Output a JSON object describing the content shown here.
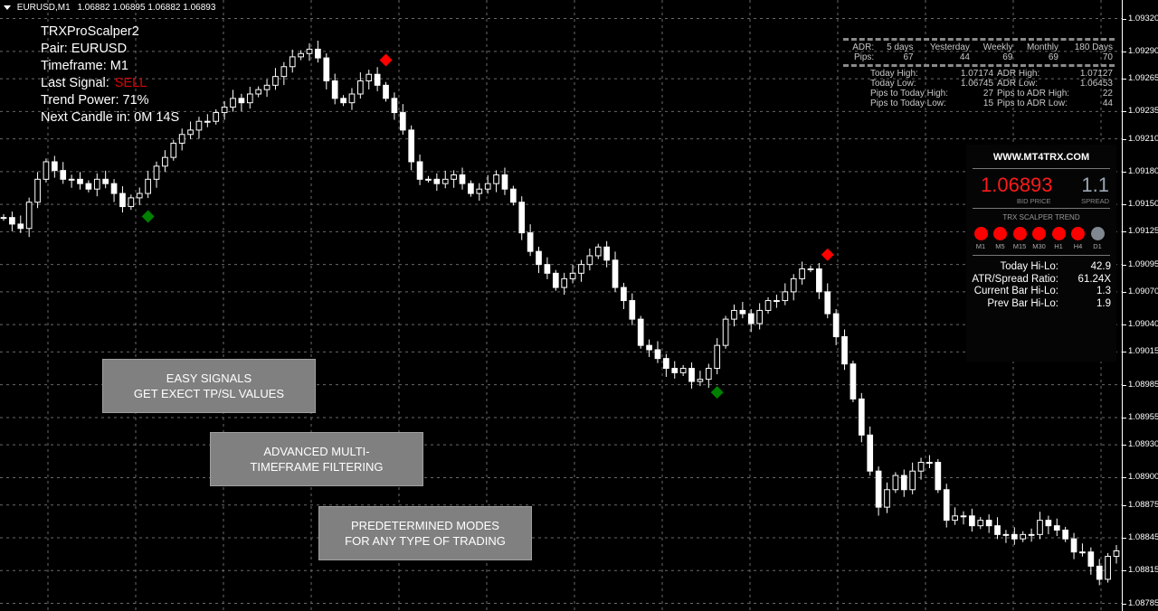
{
  "titlebar": {
    "symbol": "EURUSD,M1",
    "ohlc": "1.06882 1.06895 1.06882 1.06893"
  },
  "info": {
    "name": "TRXProScalper2",
    "pair": "Pair: EURUSD",
    "timeframe": "Timeframe: M1",
    "last_signal_label": "Last Signal:",
    "last_signal_value": "SELL",
    "trend_power": "Trend Power: 71%",
    "next_candle": "Next Candle in: 0M 14S"
  },
  "adr": {
    "header": [
      "ADR:",
      "5 days",
      "Yesterday",
      "Weekly",
      "Monthly",
      "180 Days"
    ],
    "pips": [
      "Pips:",
      "67",
      "44",
      "69",
      "69",
      "70"
    ],
    "rows": [
      [
        "Today High:",
        "1.07174",
        "ADR High:",
        "1.07127"
      ],
      [
        "Today Low:",
        "1.06745",
        "ADR Low:",
        "1.06453"
      ],
      [
        "Pips to Today High:",
        "27",
        "Pips to ADR High:",
        "22"
      ],
      [
        "Pips to Today Low:",
        "15",
        "Pips to ADR Low:",
        "44"
      ]
    ]
  },
  "panel": {
    "site": "WWW.MT4TRX.COM",
    "bid": "1.06893",
    "bid_label": "BID PRICE",
    "spread": "1.1",
    "spread_label": "SPREAD",
    "trend_label": "TRX SCALPER TREND",
    "trend": [
      {
        "tf": "M1",
        "color": "#ff0000"
      },
      {
        "tf": "M5",
        "color": "#ff0000"
      },
      {
        "tf": "M15",
        "color": "#ff0000"
      },
      {
        "tf": "M30",
        "color": "#ff0000"
      },
      {
        "tf": "H1",
        "color": "#ff0000"
      },
      {
        "tf": "H4",
        "color": "#ff0000"
      },
      {
        "tf": "D1",
        "color": "#808891"
      }
    ],
    "stats": [
      {
        "k": "Today Hi-Lo:",
        "v": "42.9"
      },
      {
        "k": "ATR/Spread Ratio:",
        "v": "61.24X"
      },
      {
        "k": "Current Bar Hi-Lo:",
        "v": "1.3"
      },
      {
        "k": "Prev Bar Hi-Lo:",
        "v": "1.9"
      }
    ]
  },
  "promos": [
    {
      "line1": "EASY SIGNALS",
      "line2": "GET EXECT TP/SL VALUES"
    },
    {
      "line1": "ADVANCED MULTI-",
      "line2": "TIMEFRAME FILTERING"
    },
    {
      "line1": "PREDETERMINED MODES",
      "line2": "FOR ANY TYPE OF TRADING"
    }
  ],
  "chart_data": {
    "type": "candlestick",
    "symbol": "EURUSD",
    "timeframe": "M1",
    "grid": true,
    "ylim": [
      1.08778,
      1.09337
    ],
    "y_ticks": [
      "1.09320",
      "1.09290",
      "1.09265",
      "1.09235",
      "1.09210",
      "1.09180",
      "1.09150",
      "1.09125",
      "1.09095",
      "1.09070",
      "1.09040",
      "1.09015",
      "1.08985",
      "1.08955",
      "1.08930",
      "1.08900",
      "1.08875",
      "1.08845",
      "1.08815",
      "1.08785"
    ],
    "colors": {
      "candle": "#ffffff",
      "buy": "#008000",
      "sell": "#ff0000",
      "background": "#000000"
    },
    "closes": [
      1.09138,
      1.09132,
      1.09128,
      1.09152,
      1.09173,
      1.09189,
      1.09181,
      1.09173,
      1.09173,
      1.09169,
      1.09164,
      1.09173,
      1.09169,
      1.0916,
      1.09148,
      1.09156,
      1.0916,
      1.09173,
      1.09185,
      1.09193,
      1.09206,
      1.09214,
      1.09218,
      1.09226,
      1.09226,
      1.09234,
      1.09239,
      1.09247,
      1.09243,
      1.09251,
      1.09255,
      1.09259,
      1.09267,
      1.09276,
      1.09285,
      1.09288,
      1.09292,
      1.09284,
      1.09263,
      1.09247,
      1.09243,
      1.09251,
      1.09263,
      1.09269,
      1.09259,
      1.09247,
      1.09234,
      1.09218,
      1.09189,
      1.09173,
      1.09173,
      1.09169,
      1.09173,
      1.09177,
      1.09169,
      1.0916,
      1.09164,
      1.09169,
      1.09177,
      1.09164,
      1.09152,
      1.09124,
      1.09107,
      1.09095,
      1.09087,
      1.09074,
      1.09082,
      1.09087,
      1.09095,
      1.09103,
      1.09111,
      1.09099,
      1.09074,
      1.09062,
      1.09045,
      1.09021,
      1.09017,
      1.09009,
      1.09,
      1.08996,
      1.09,
      1.08988,
      1.0899,
      1.09,
      1.09021,
      1.09045,
      1.09053,
      1.0905,
      1.09041,
      1.09053,
      1.09062,
      1.09062,
      1.0907,
      1.09082,
      1.09091,
      1.09091,
      1.0907,
      1.0905,
      1.09029,
      1.09004,
      1.08972,
      1.08939,
      1.08906,
      1.08873,
      1.08889,
      1.08902,
      1.08889,
      1.08906,
      1.08914,
      1.08914,
      1.08889,
      1.08861,
      1.08865,
      1.08865,
      1.08856,
      1.08861,
      1.08856,
      1.08848,
      1.08848,
      1.08844,
      1.08848,
      1.08848,
      1.08861,
      1.08856,
      1.08852,
      1.08844,
      1.08832,
      1.08832,
      1.08819,
      1.08807,
      1.08828,
      1.08833
    ],
    "signals": [
      {
        "type": "buy",
        "index": 17,
        "price": 1.09139
      },
      {
        "type": "sell",
        "index": 45,
        "price": 1.09282
      },
      {
        "type": "buy",
        "index": 84,
        "price": 1.08978
      },
      {
        "type": "sell",
        "index": 97,
        "price": 1.09104
      }
    ]
  }
}
